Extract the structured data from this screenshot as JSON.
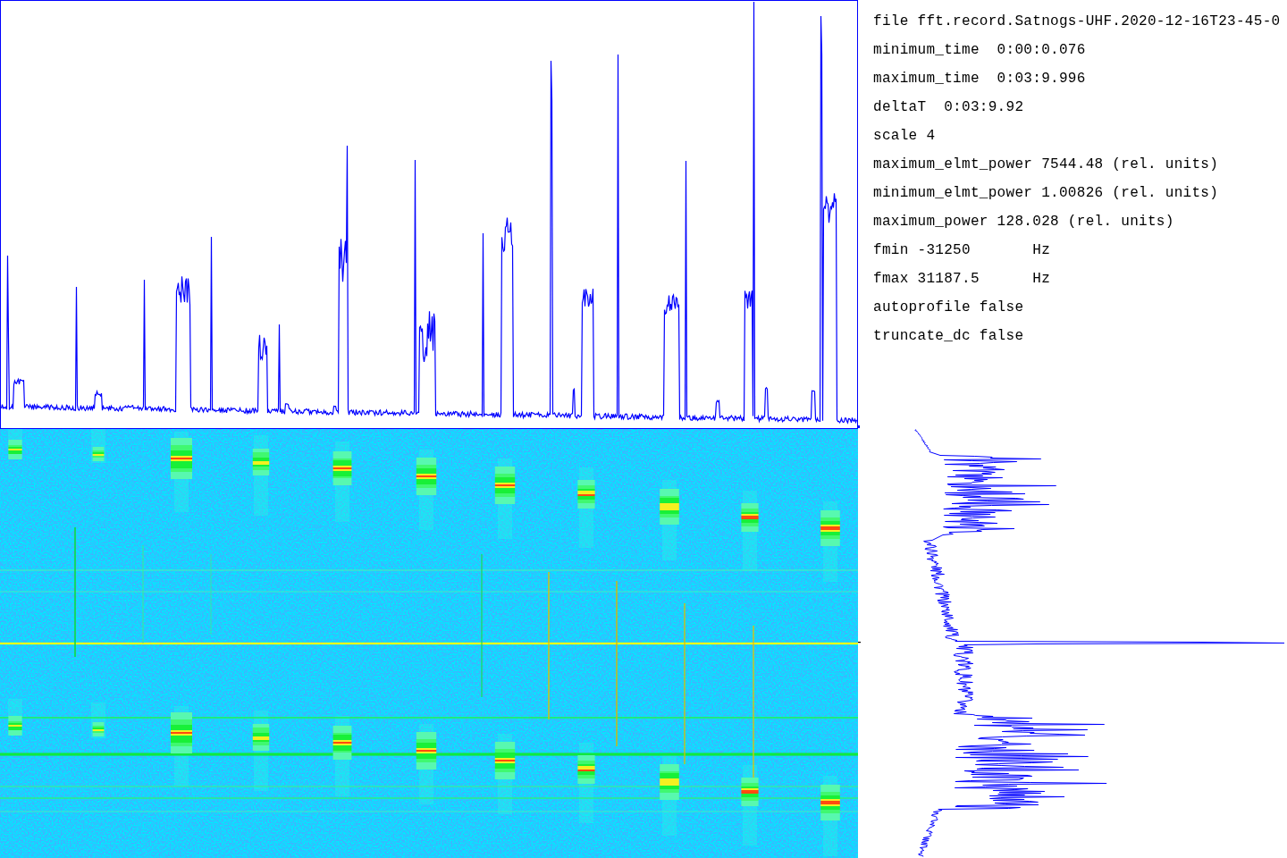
{
  "parameters": [
    "file fft.record.Satnogs-UHF.2020-12-16T23-45-0",
    "minimum_time  0:00:0.076",
    "maximum_time  0:03:9.996",
    "deltaT  0:03:9.92",
    "scale 4",
    "maximum_elmt_power 7544.48 (rel. units)",
    "minimum_elmt_power 1.00826 (rel. units)",
    "maximum_power 128.028 (rel. units)",
    "fmin -31250       Hz",
    "fmax 31187.5      Hz",
    "autoprofile false",
    "truncate_dc false"
  ]
}
